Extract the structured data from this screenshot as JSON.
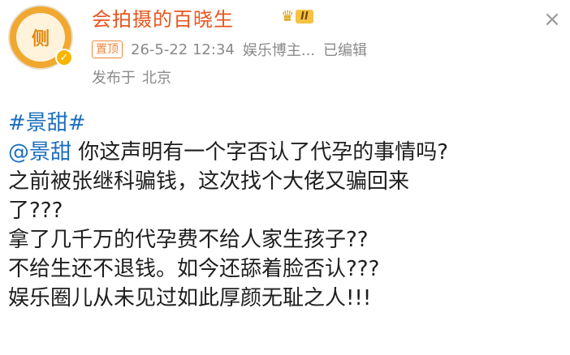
{
  "header": {
    "avatar_text": "侧",
    "verified_mark": "✓",
    "username": "会拍摄的百晓生",
    "level_label": "II",
    "pinned_label": "置顶",
    "timestamp": "26-5-22 12:34",
    "source": "娱乐博主...",
    "edited_label": "已编辑",
    "location_prefix": "发布于",
    "location": "北京",
    "close_label": "×"
  },
  "post": {
    "topic": "#景甜#",
    "mention": "@景甜",
    "line1_rest": " 你这声明有一个字否认了代孕的事情吗?",
    "line2": "之前被张继科骗钱，这次找个大佬又骗回来",
    "line3": "了???",
    "line4": "拿了几千万的代孕费不给人家生孩子??",
    "line5": "不给生还不退钱。如今还舔着脸否认???",
    "line6": "娱乐圈儿从未见过如此厚颜无耻之人!!!"
  },
  "colors": {
    "username": "#e8561e",
    "link": "#1d6fbf",
    "meta": "#8a8a8a",
    "pinned": "#f0853a"
  }
}
